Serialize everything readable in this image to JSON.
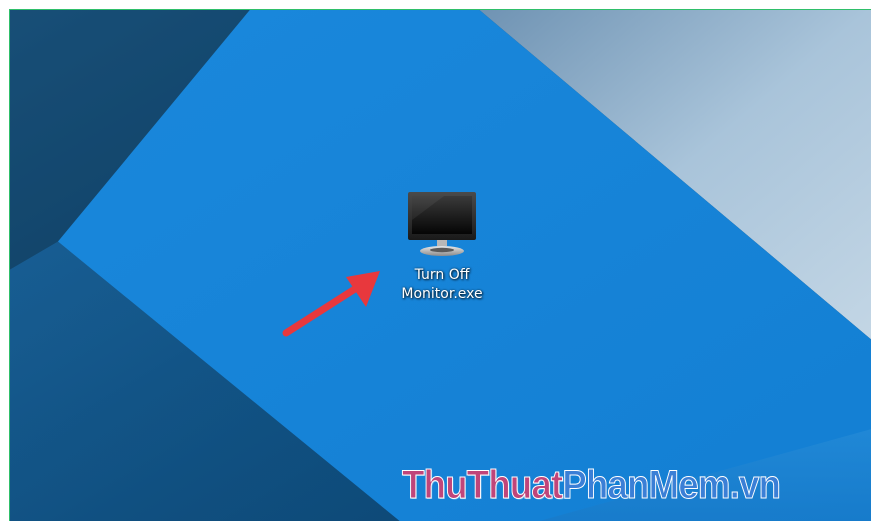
{
  "desktop": {
    "icon": {
      "icon_name": "monitor-icon",
      "label": "Turn Off\nMonitor.exe"
    },
    "annotation": {
      "icon_name": "red-arrow",
      "color": "#e8383d"
    }
  },
  "watermark": {
    "part1": "ThuThuat",
    "part2": "PhanMem.vn",
    "color_part1": "#c0457a",
    "color_part2": "#3b7fd6"
  },
  "colors": {
    "wallpaper_blue": "#1683d8",
    "wallpaper_dark": "#0b3b5e",
    "wallpaper_light": "#a9c4da",
    "frame_border": "#2fbf6a"
  }
}
